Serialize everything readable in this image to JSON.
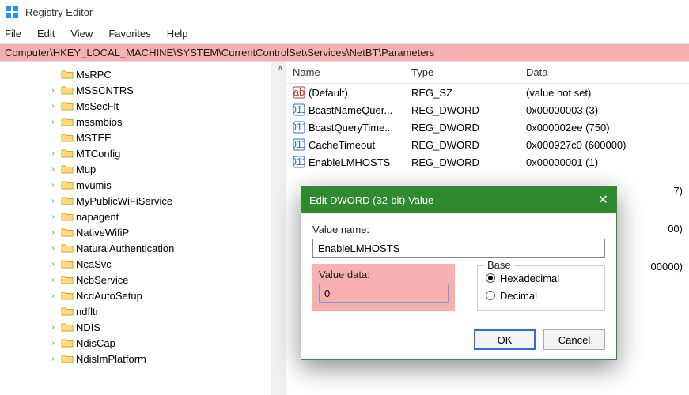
{
  "window": {
    "title": "Registry Editor"
  },
  "menu": {
    "file": "File",
    "edit": "Edit",
    "view": "View",
    "favorites": "Favorites",
    "help": "Help"
  },
  "address": {
    "path": "Computer\\HKEY_LOCAL_MACHINE\\SYSTEM\\CurrentControlSet\\Services\\NetBT\\Parameters"
  },
  "tree": {
    "items": [
      {
        "label": "MsRPC",
        "expandable": false
      },
      {
        "label": "MSSCNTRS",
        "expandable": true
      },
      {
        "label": "MsSecFlt",
        "expandable": true
      },
      {
        "label": "mssmbios",
        "expandable": true
      },
      {
        "label": "MSTEE",
        "expandable": false
      },
      {
        "label": "MTConfig",
        "expandable": true
      },
      {
        "label": "Mup",
        "expandable": true
      },
      {
        "label": "mvumis",
        "expandable": true
      },
      {
        "label": "MyPublicWiFiService",
        "expandable": true
      },
      {
        "label": "napagent",
        "expandable": true
      },
      {
        "label": "NativeWifiP",
        "expandable": true
      },
      {
        "label": "NaturalAuthentication",
        "expandable": true
      },
      {
        "label": "NcaSvc",
        "expandable": true
      },
      {
        "label": "NcbService",
        "expandable": true
      },
      {
        "label": "NcdAutoSetup",
        "expandable": true
      },
      {
        "label": "ndfltr",
        "expandable": false
      },
      {
        "label": "NDIS",
        "expandable": true
      },
      {
        "label": "NdisCap",
        "expandable": true
      },
      {
        "label": "NdisImPlatform",
        "expandable": true
      }
    ]
  },
  "list": {
    "cols": {
      "name": "Name",
      "type": "Type",
      "data": "Data"
    },
    "rows": [
      {
        "icon": "string",
        "name": "(Default)",
        "type": "REG_SZ",
        "data": "(value not set)"
      },
      {
        "icon": "dword",
        "name": "BcastNameQuer...",
        "type": "REG_DWORD",
        "data": "0x00000003 (3)"
      },
      {
        "icon": "dword",
        "name": "BcastQueryTime...",
        "type": "REG_DWORD",
        "data": "0x000002ee (750)"
      },
      {
        "icon": "dword",
        "name": "CacheTimeout",
        "type": "REG_DWORD",
        "data": "0x000927c0 (600000)"
      },
      {
        "icon": "dword",
        "name": "EnableLMHOSTS",
        "type": "REG_DWORD",
        "data": "0x00000001 (1)"
      }
    ],
    "peek_tails": {
      "a": "7)",
      "b": "00)",
      "c": "00000)"
    }
  },
  "dialog": {
    "title": "Edit DWORD (32-bit) Value",
    "value_name_label": "Value name:",
    "value_name": "EnableLMHOSTS",
    "value_data_label": "Value data:",
    "value_data": "0",
    "base_label": "Base",
    "radio_hex": "Hexadecimal",
    "radio_dec": "Decimal",
    "selected_base": "hex",
    "ok": "OK",
    "cancel": "Cancel"
  }
}
